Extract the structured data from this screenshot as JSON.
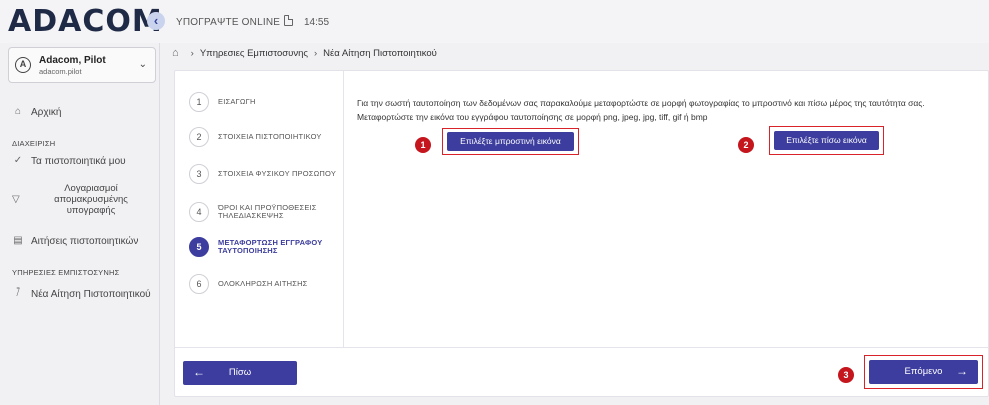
{
  "header": {
    "logo": "ADACOM",
    "collapse_icon": "‹",
    "sign_online": "ΥΠΟΓΡΑΨΤΕ ONLINE",
    "time": "14:55"
  },
  "user": {
    "avatar_glyph": "A",
    "name": "Adacom, Pilot",
    "username": "adacom.pilot"
  },
  "sidebar": {
    "home": "Αρχική",
    "section_manage": "ΔΙΑΧΕΙΡΙΣΗ",
    "my_certificates": "Τα πιστοποιητικά μου",
    "remote_accounts": "Λογαριασμοί απομακρυσμένης υπογραφής",
    "cert_requests": "Αιτήσεις πιστοποιητικών",
    "section_services": "ΥΠΗΡΕΣΙΕΣ ΕΜΠΙΣΤΟΣΥΝΗΣ",
    "new_request": "Νέα Αίτηση Πιστοποιητικού"
  },
  "breadcrumb": {
    "items": [
      "Υπηρεσιες Εμπιστοσυνης",
      "Νέα Αίτηση Πιστοποιητικού"
    ]
  },
  "steps": [
    {
      "num": "1",
      "label": "ΕΙΣΑΓΩΓΗ"
    },
    {
      "num": "2",
      "label": "ΣΤΟΙΧΕΙΑ ΠΙΣΤΟΠΟΙΗΤΙΚΟΥ"
    },
    {
      "num": "3",
      "label": "ΣΤΟΙΧΕΙΑ ΦΥΣΙΚΟΥ ΠΡΟΣΩΠΟΥ"
    },
    {
      "num": "4",
      "label": "ΌΡΟΙ ΚΑΙ ΠΡΟΫΠΟΘΕΣΕΙΣ ΤΗΛΕΔΙΑΣΚΕΨΗΣ"
    },
    {
      "num": "5",
      "label": "ΜΕΤΑΦΟΡΤΩΣΗ ΕΓΓΡΑΦΟΥ ΤΑΥΤΟΠΟΙΗΣΗΣ"
    },
    {
      "num": "6",
      "label": "ΟΛΟΚΛΗΡΩΣΗ ΑΙΤΗΣΗΣ"
    }
  ],
  "content": {
    "instruction_1": "Για την σωστή ταυτοποίηση των δεδομένων σας παρακαλούμε μεταφορτώστε σε μορφή φωτογραφίας το μπροστινό και πίσω μέρος της ταυτότητα σας.",
    "instruction_2": "Μεταφορτώστε την εικόνα του εγγράφου ταυτοποίησης σε μορφή png, jpeg, jpg, tiff, gif ή bmp",
    "front_button": "Επιλέξτε μπροστινή εικόνα",
    "back_button": "Επιλέξτε πίσω εικόνα",
    "badge_1": "1",
    "badge_2": "2",
    "badge_3": "3"
  },
  "footer": {
    "back": "Πίσω",
    "next": "Επόμενο"
  },
  "colors": {
    "primary": "#3c3d9e",
    "highlight": "#d9232a",
    "badge": "#c4161c"
  }
}
